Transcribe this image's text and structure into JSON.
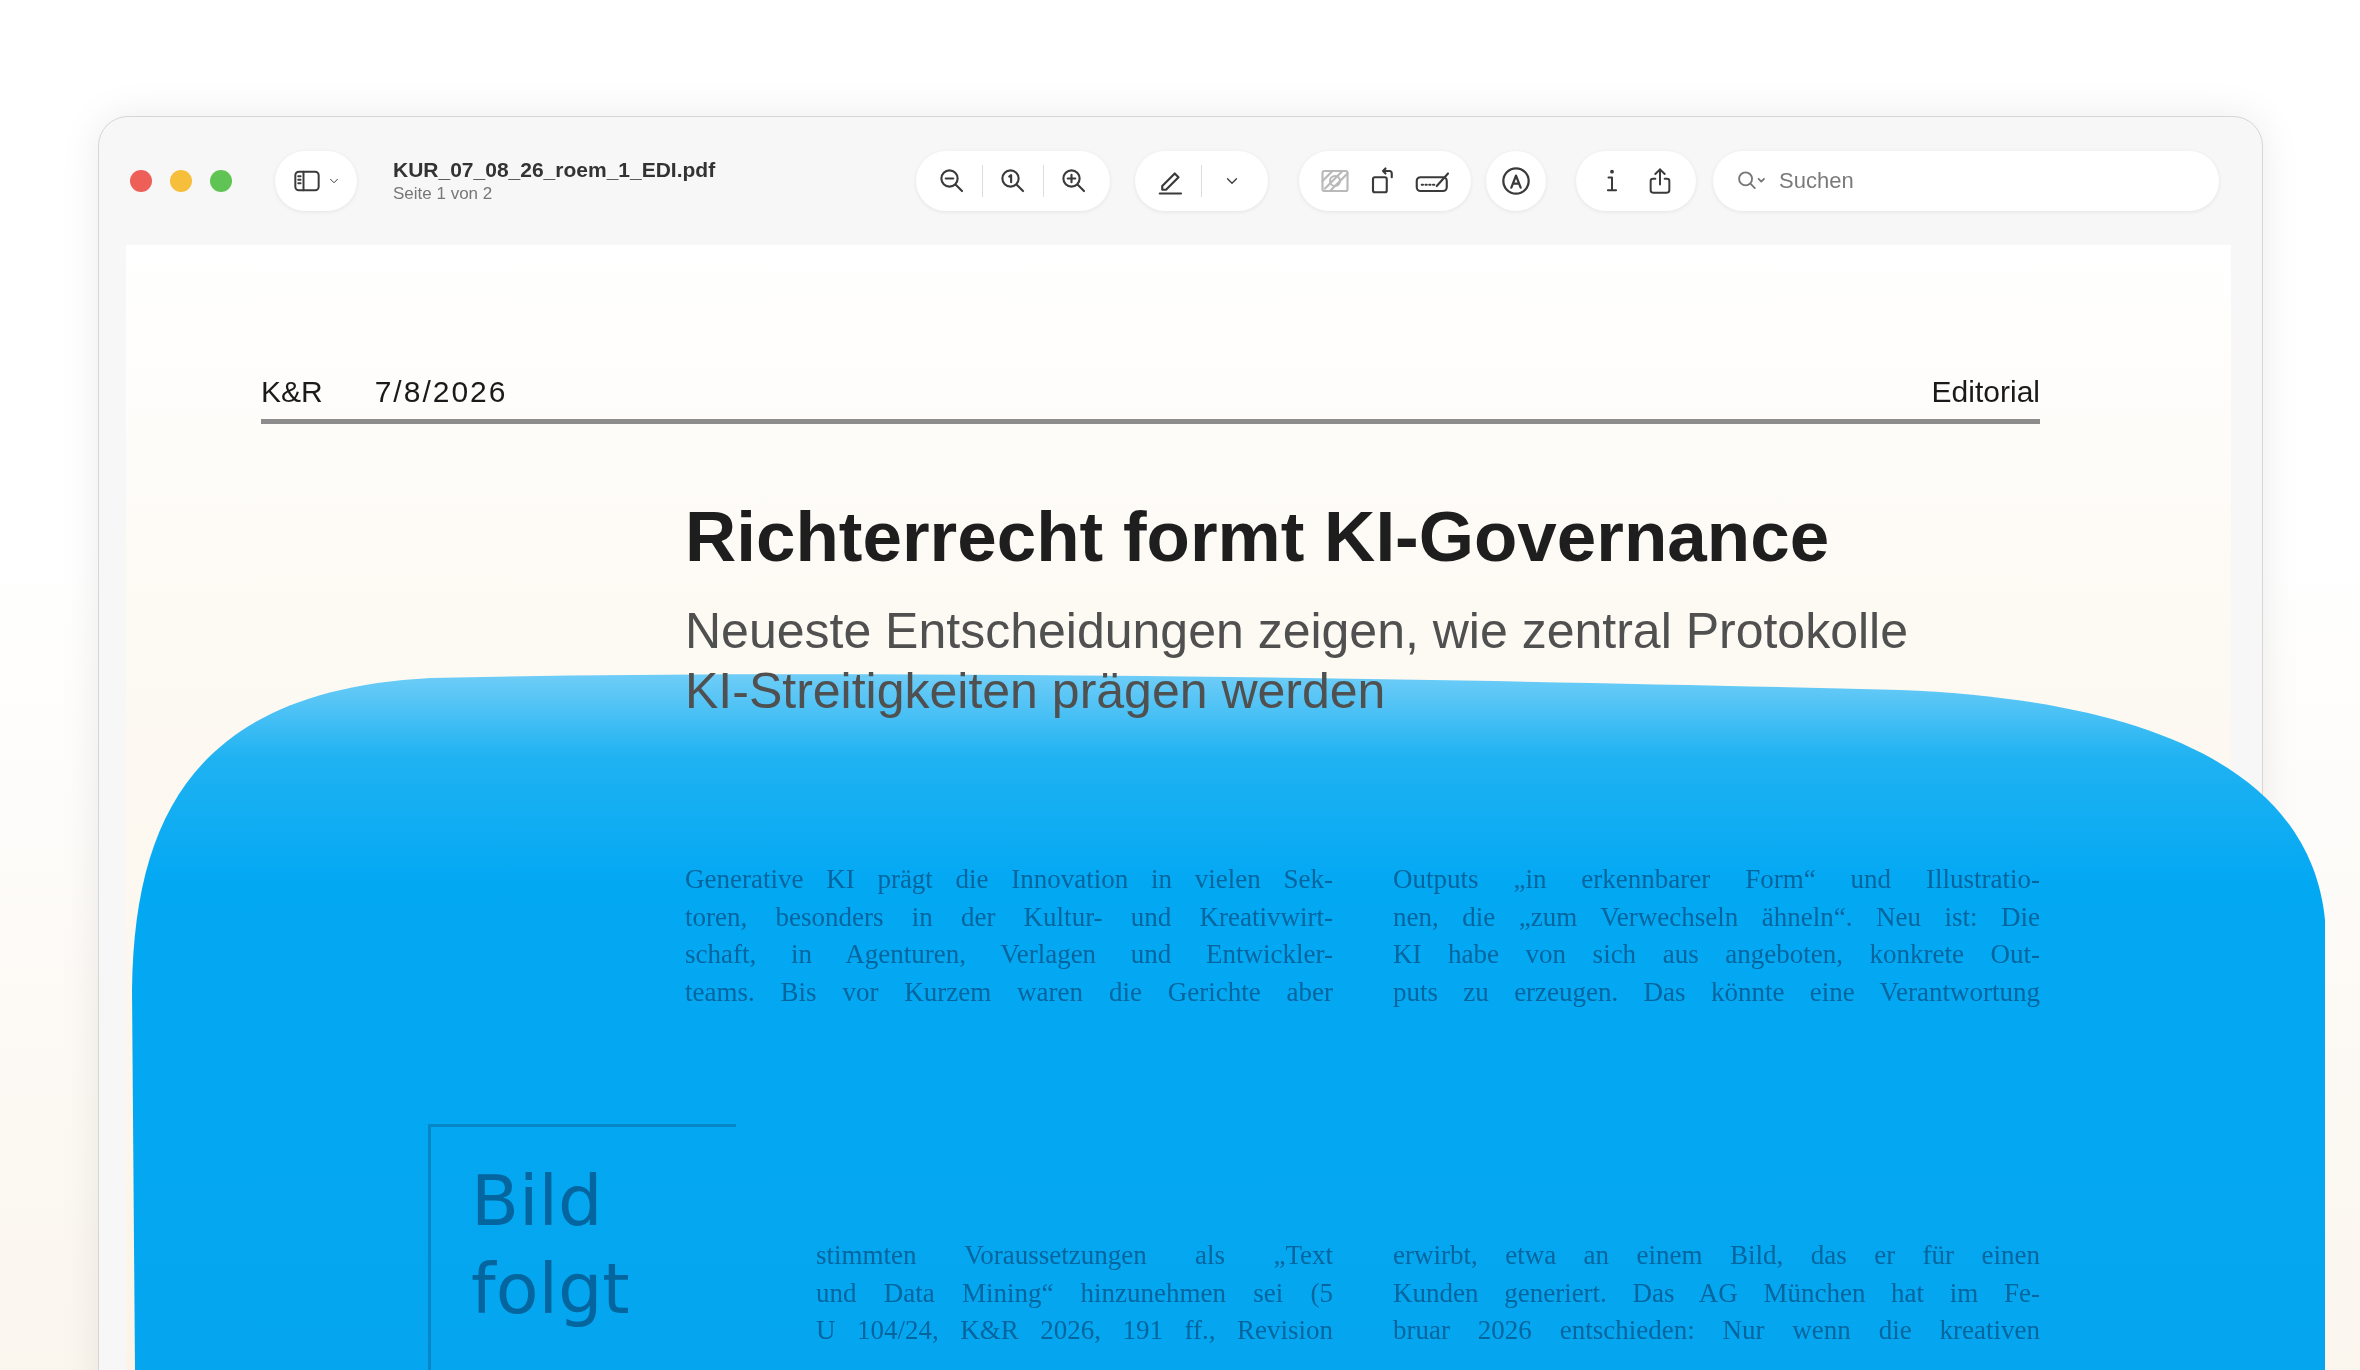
{
  "window": {
    "title": "KUR_07_08_26_roem_1_EDI.pdf",
    "subtitle": "Seite 1 von 2"
  },
  "markup_tools": [
    {
      "disabled": true
    },
    {
      "disabled": false
    },
    {
      "disabled": false
    }
  ],
  "search": {
    "placeholder": "Suchen"
  },
  "page": {
    "journal": "K&R",
    "date": "7/8/2026",
    "section": "Editorial",
    "title": "Richterrecht formt KI-Governance",
    "subtitle": "Neueste Entscheidungen zeigen, wie zentral Protokolle KI-Streitigkeiten prägen werden",
    "image_placeholder": "Bild folgt",
    "text_blocks": [
      {
        "lines": [
          "Generative KI prägt die Innovation in vielen Sek-",
          "toren, besonders in der Kultur- und Kreativwirt-",
          "schaft, in Agenturen, Verlagen und Entwickler-",
          "teams. Bis vor Kurzem waren die Gerichte aber"
        ]
      },
      {
        "lines": [
          "Outputs „in erkennbarer Form“ und Illustratio-",
          "nen, die „zum Verwechseln ähneln“. Neu ist: Die",
          "KI habe von sich aus angeboten, konkrete Out-",
          "puts zu erzeugen. Das könnte eine Verantwortung"
        ]
      },
      {
        "lines": [
          "stimmten Voraussetzungen als „Text",
          "und Data Mining“ hinzunehmen sei (5",
          "U 104/24, K&R 2026, 191 ff., Revision"
        ]
      },
      {
        "lines": [
          "erwirbt, etwa an einem Bild, das er für einen",
          "Kunden generiert. Das AG München hat im Fe-",
          "bruar 2026 entschieden: Nur wenn die kreativen"
        ]
      }
    ]
  }
}
